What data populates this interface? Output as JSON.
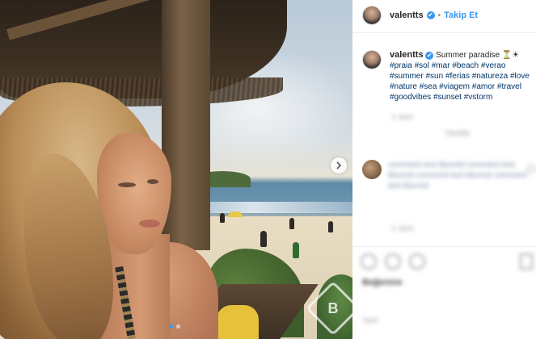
{
  "post": {
    "username": "valentts",
    "follow_label": "Takip Et",
    "separator": "•",
    "verified_mark": "✔",
    "caption_text": "Summer paradise",
    "caption_emoji": "⏳☀",
    "hashtags": [
      "#praia",
      "#sol",
      "#mar",
      "#beach",
      "#verao",
      "#summer",
      "#sun",
      "#ferias",
      "#natureza",
      "#love",
      "#nature",
      "#sea",
      "#viagem",
      "#amor",
      "#travel",
      "#goodvibes",
      "#sunset",
      "#vstorm"
    ],
    "blurred_timestamp": "1 sem",
    "blurred_caption_reply": "Yanıtla",
    "blurred_comment_text": "comment text blurred comment text blurred comment text blurred comment text blurred",
    "blurred_comment_meta": "1 sem",
    "blurred_likes": "Beğenme",
    "blurred_date": "Tarih"
  },
  "media": {
    "next_icon": "chevron-right-icon",
    "dots": [
      true,
      false
    ],
    "watermark_letter": "B"
  },
  "icons": {
    "verified": "verified-badge-icon",
    "like": "heart-icon",
    "comment": "comment-icon",
    "share": "share-icon",
    "save": "bookmark-icon"
  },
  "colors": {
    "link": "#3897f0",
    "hashtag": "#003569",
    "text": "#262626"
  }
}
